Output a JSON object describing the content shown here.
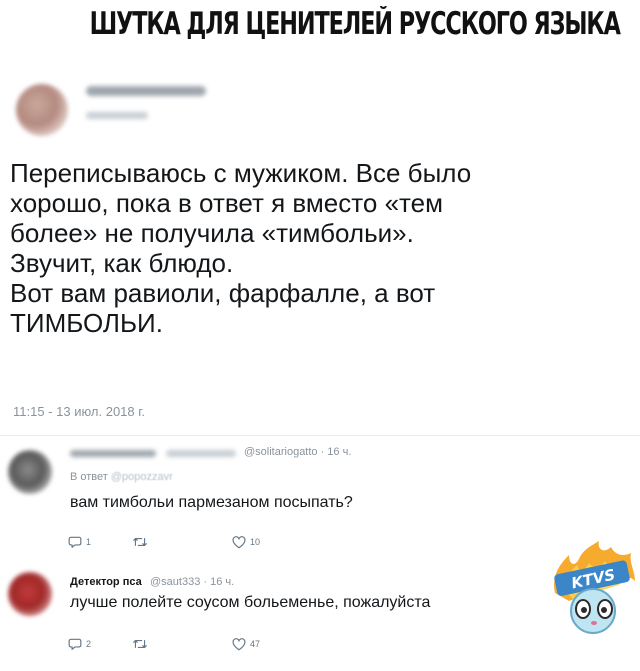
{
  "headline": "ШУТКА ДЛЯ ЦЕНИТЕЛЕЙ РУССКОГО ЯЗЫКА",
  "tweet": {
    "lines": [
      "Переписываюсь с мужиком. Все было",
      "хорошо, пока в ответ я вместо «тем",
      "более» не получила «тимбольи».",
      "Звучит, как блюдо.",
      "Вот вам равиоли, фарфалле, а вот",
      "ТИМБОЛЬИ."
    ],
    "timestamp": "11:15 - 13 июл. 2018 г."
  },
  "replies": [
    {
      "handle_time": "@solitariogatto · 16 ч.",
      "reply_prefix": "В ответ",
      "reply_handle": "@popozzavr",
      "text": "вам тимбольи пармезаном посыпать?",
      "counts": {
        "replies": "1",
        "retweets": "",
        "likes": "10"
      }
    },
    {
      "name": "Детектор пса",
      "handle_time": "@saut333 · 16 ч.",
      "text": "лучше полейте соусом больеменье, пожалуйста",
      "counts": {
        "replies": "2",
        "retweets": "",
        "likes": "47"
      }
    }
  ],
  "watermark": {
    "text": "KTVS",
    "colors": {
      "flame": "#f5a623",
      "face": "#bfe4f2",
      "accent": "#3a86c8"
    }
  },
  "icons": [
    "reply-icon",
    "retweet-icon",
    "like-icon"
  ]
}
